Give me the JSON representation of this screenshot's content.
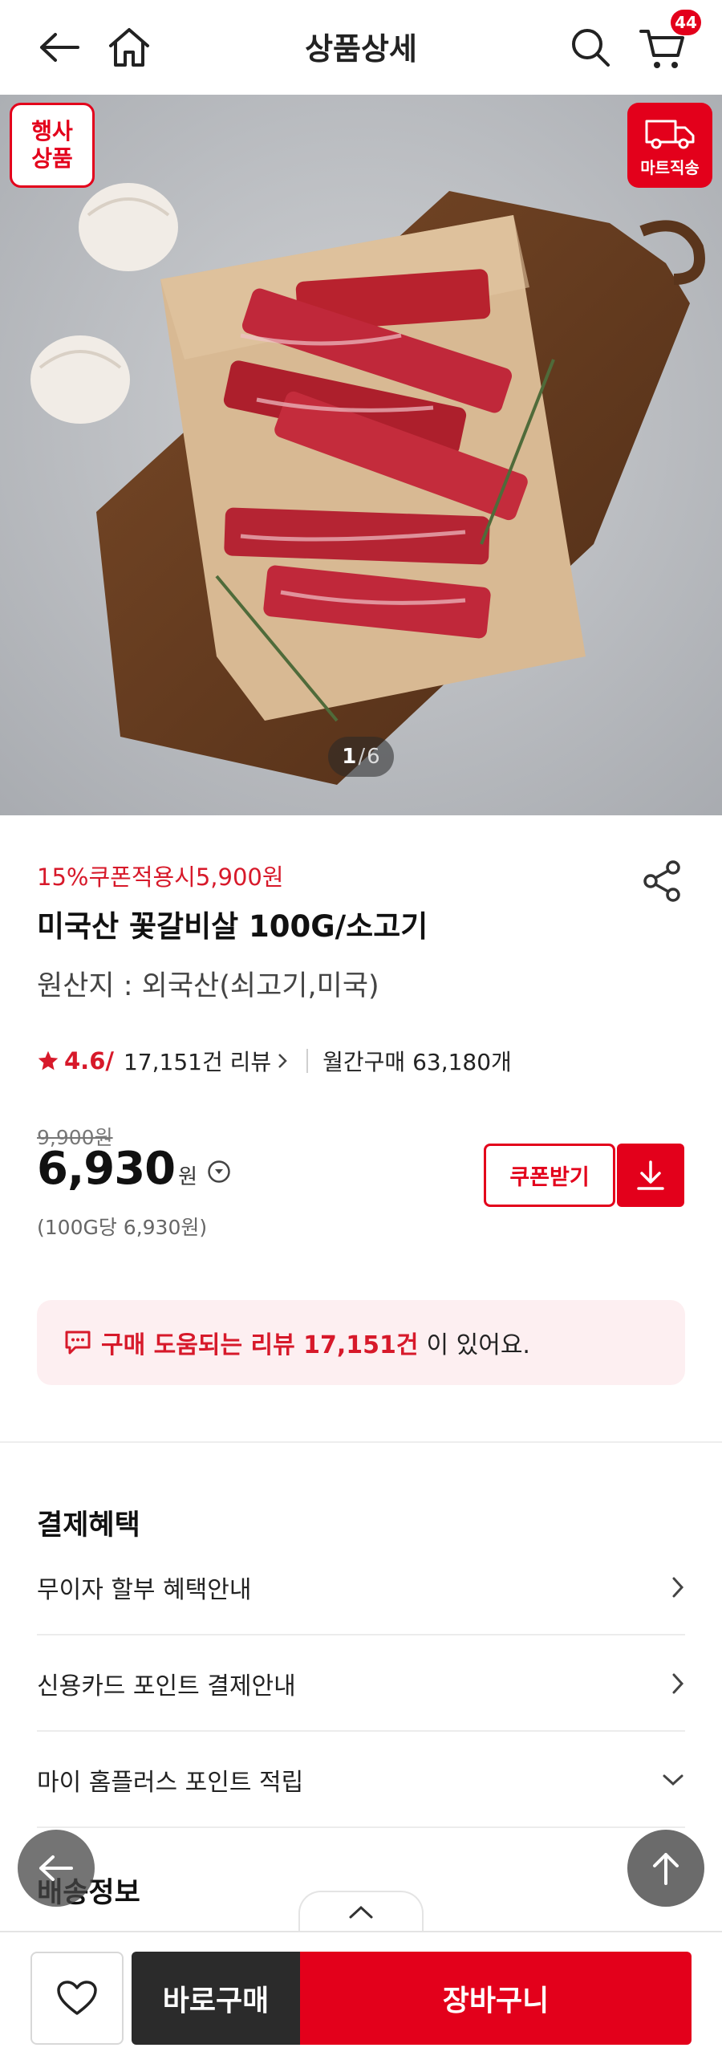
{
  "header": {
    "title": "상품상세",
    "cart_count": "44",
    "icons": [
      "back-arrow-icon",
      "home-icon",
      "search-icon",
      "cart-icon"
    ]
  },
  "hero": {
    "badge_event_line1": "행사",
    "badge_event_line2": "상품",
    "badge_direct": "마트직송",
    "pager_current": "1",
    "pager_sep": "/",
    "pager_total": "6",
    "accent_color": "#e3001b"
  },
  "product": {
    "coupon_text": "15%쿠폰적용시5,900원",
    "name": "미국산 꽃갈비살 100G/소고기",
    "origin": "원산지 : 외국산(쇠고기,미국)",
    "rating": "4.6/",
    "review_count": "17,151건 리뷰",
    "monthly": "월간구매 63,180개",
    "original_price": "9,900원",
    "price": "6,930",
    "price_unit": "원",
    "unit_price": "(100G당 6,930원)",
    "coupon_button": "쿠폰받기"
  },
  "review_banner": {
    "highlight": "구매 도움되는 리뷰 17,151건",
    "tail": "이 있어요."
  },
  "benefits": {
    "title": "결제혜택",
    "items": [
      {
        "label": "무이자 할부 혜택안내",
        "icon": "chevron-right-icon"
      },
      {
        "label": "신용카드 포인트 결제안내",
        "icon": "chevron-right-icon"
      },
      {
        "label": "마이 홈플러스 포인트 적립",
        "icon": "chevron-down-icon"
      }
    ]
  },
  "shipping": {
    "title": "배송정보"
  },
  "bottom_bar": {
    "buy_now": "바로구매",
    "add_to_cart": "장바구니"
  }
}
